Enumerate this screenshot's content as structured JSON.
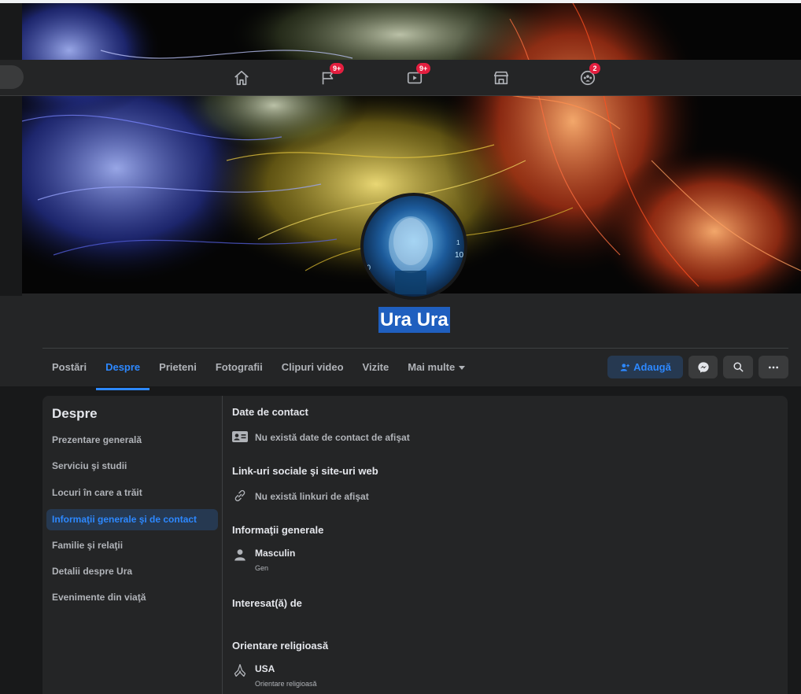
{
  "navbar": {
    "items": [
      {
        "name": "home",
        "badge": ""
      },
      {
        "name": "pages",
        "badge": "9+"
      },
      {
        "name": "watch",
        "badge": "9+"
      },
      {
        "name": "marketplace",
        "badge": ""
      },
      {
        "name": "groups",
        "badge": "2"
      }
    ]
  },
  "profile": {
    "name": "Ura Ura"
  },
  "tabs": {
    "items": [
      "Postări",
      "Despre",
      "Prieteni",
      "Fotografii",
      "Clipuri video",
      "Vizite",
      "Mai multe"
    ],
    "active": "Despre"
  },
  "actions": {
    "add_label": "Adaugă"
  },
  "about": {
    "title": "Despre",
    "side_items": [
      "Prezentare generală",
      "Serviciu şi studii",
      "Locuri în care a trăit",
      "Informaţii generale şi de contact",
      "Familie şi relaţii",
      "Detalii despre Ura",
      "Evenimente din viaţă"
    ],
    "active_item": "Informaţii generale şi de contact",
    "contact_title": "Date de contact",
    "contact_empty": "Nu există date de contact de afişat",
    "links_title": "Link-uri sociale şi site-uri web",
    "links_empty": "Nu există linkuri de afişat",
    "general_title": "Informaţii generale",
    "gender_value": "Masculin",
    "gender_label": "Gen",
    "interested_title": "Interesat(ă) de",
    "religion_title": "Orientare religioasă",
    "religion_value": "USA",
    "religion_label": "Orientare religioasă"
  },
  "colors": {
    "accent": "#2d88ff",
    "badge": "#e41e3f",
    "surface": "#242526",
    "background": "#18191a",
    "selection": "#1f5fbf"
  }
}
